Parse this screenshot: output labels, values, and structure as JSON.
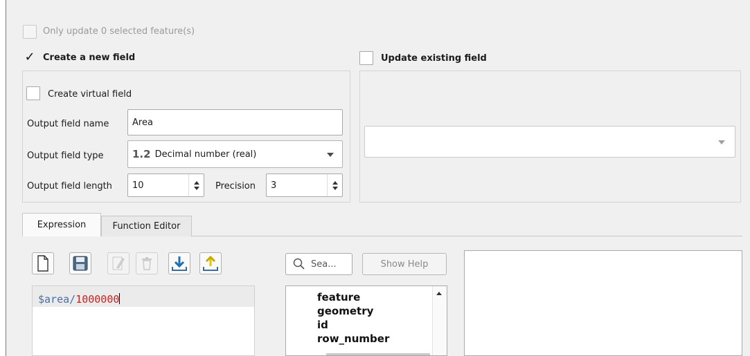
{
  "only_update": {
    "label": "Only update 0 selected feature(s)",
    "checked": false,
    "enabled": false
  },
  "create_new_field": {
    "label": "Create a new field",
    "checked": true,
    "check_glyph": "✓",
    "virtual_field_label": "Create virtual field",
    "output_name_label": "Output field name",
    "output_name_value": "Area",
    "output_type_label": "Output field type",
    "output_type_badge": "1.2",
    "output_type_value": "Decimal number (real)",
    "output_length_label": "Output field length",
    "output_length_value": "10",
    "precision_label": "Precision",
    "precision_value": "3"
  },
  "update_existing": {
    "label": "Update existing field",
    "checked": false,
    "field_value": ""
  },
  "tabs": [
    {
      "label": "Expression",
      "active": true
    },
    {
      "label": "Function Editor",
      "active": false
    }
  ],
  "toolbar": {
    "icons": [
      "new-file-icon",
      "save-icon",
      "edit-icon",
      "delete-icon",
      "load-icon",
      "export-icon"
    ]
  },
  "expression": {
    "variable": "$area",
    "operator": "/",
    "number": "1000000",
    "variable_color": "#4a6fa5",
    "operator_color": "#4a6fa5",
    "number_color": "#cc2222"
  },
  "search": {
    "placeholder": "Sea..."
  },
  "show_help_label": "Show Help",
  "function_tree": {
    "items": [
      "feature",
      "geometry",
      "id",
      "row_number"
    ]
  },
  "colors": {
    "accent_blue": "#1d6fc4",
    "load_arrow_blue": "#1f6fb5",
    "export_arrow_yellow": "#e8c400"
  }
}
